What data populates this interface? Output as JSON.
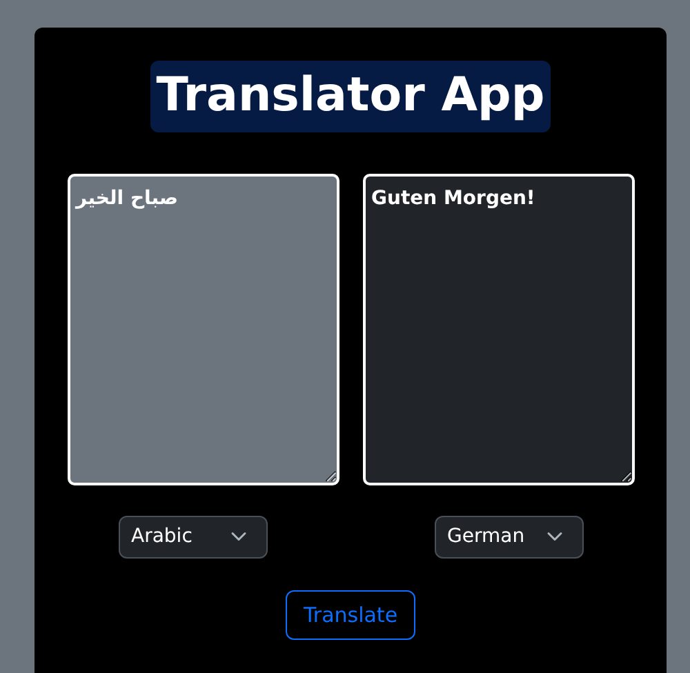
{
  "title": "Translator App",
  "panes": [
    {
      "value": "صباح الخير",
      "kind": "source"
    },
    {
      "value": "Guten Morgen!",
      "kind": "target"
    }
  ],
  "languages": [
    {
      "value": "Arabic"
    },
    {
      "value": "German"
    }
  ],
  "button": "Translate"
}
